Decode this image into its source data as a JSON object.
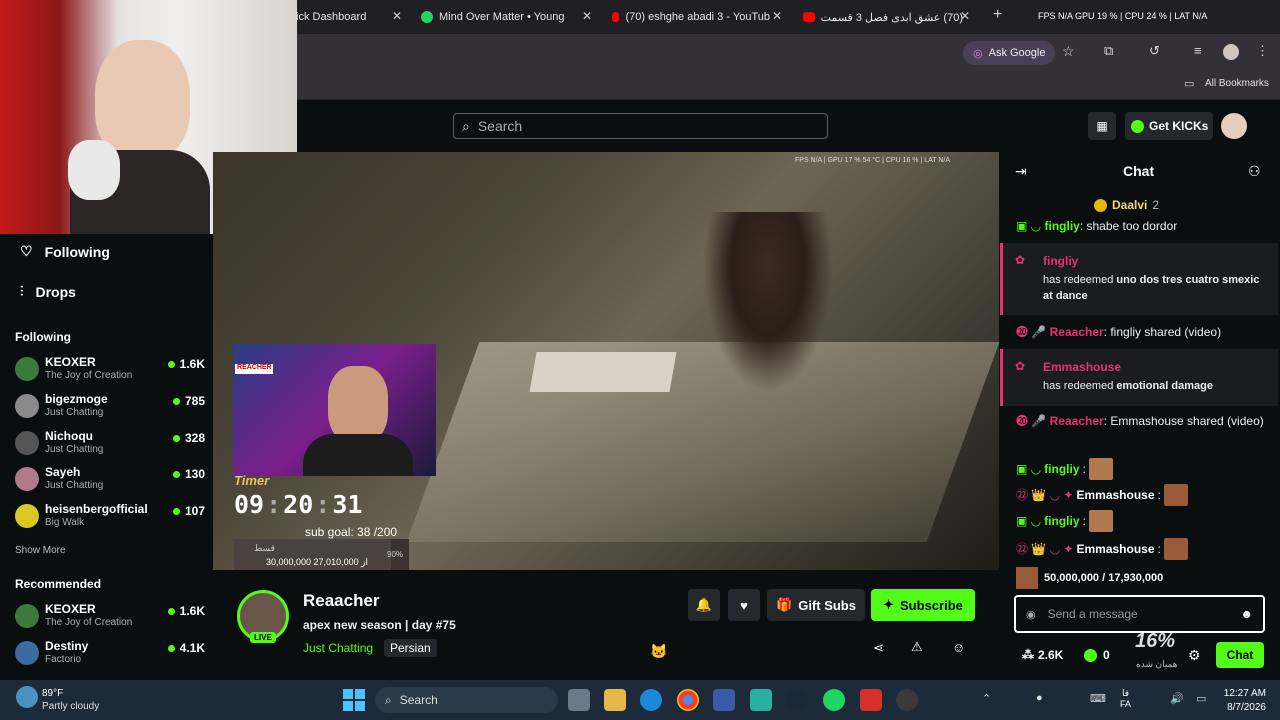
{
  "browser": {
    "tabs": [
      {
        "label": "ick Dashboard"
      },
      {
        "label": "Mind Over Matter • Young"
      },
      {
        "label": "(70) eshghe abadi 3 - YouTub"
      },
      {
        "label": "(70) عشق ابدی فصل 3 قسمت"
      }
    ],
    "perf_overlay": "FPS  N/A  GPU  19 %  |  CPU  24 %  |  LAT  N/A",
    "ask_google": "Ask Google",
    "all_bookmarks": "All Bookmarks"
  },
  "kick": {
    "search_placeholder": "Search",
    "get_kicks": "Get KICKs"
  },
  "sidebar": {
    "following_nav": "Following",
    "drops_nav": "Drops",
    "following_header": "Following",
    "following": [
      {
        "name": "KEOXER",
        "category": "The Joy of Creation",
        "viewers": "1.6K",
        "color": "#3a7a3a"
      },
      {
        "name": "bigezmoge",
        "category": "Just Chatting",
        "viewers": "785",
        "color": "#8a8a8a"
      },
      {
        "name": "Nichoqu",
        "category": "Just Chatting",
        "viewers": "328",
        "color": "#555"
      },
      {
        "name": "Sayeh",
        "category": "Just Chatting",
        "viewers": "130",
        "color": "#b07a8a"
      },
      {
        "name": "heisenbergofficial",
        "category": "Big Walk",
        "viewers": "107",
        "color": "#d8c820"
      }
    ],
    "show_more": "Show More",
    "recommended_header": "Recommended",
    "recommended": [
      {
        "name": "KEOXER",
        "category": "The Joy of Creation",
        "viewers": "1.6K",
        "color": "#3a7a3a"
      },
      {
        "name": "Destiny",
        "category": "Factorio",
        "viewers": "4.1K",
        "color": "#3a6aa0"
      }
    ]
  },
  "video": {
    "stats": "FPS  N/A  |  GPU  17 %  54 °C  |  CPU  16 %  |  LAT  N/A",
    "timer_label": "Timer",
    "timer_hh": "09",
    "timer_mm": "20",
    "timer_ss": "31",
    "sub_goal": "sub goal: 38 /200",
    "overlay_persian": "قسط",
    "overlay_amounts": "30,000,000 از 27,010,000",
    "overlay_percent": "90%",
    "cam_label": "REACHER"
  },
  "streamer": {
    "name": "Reaacher",
    "title": "apex new season | day #75",
    "category": "Just Chatting",
    "tag": "Persian",
    "live_badge": "LIVE",
    "gift_subs": "Gift Subs",
    "subscribe": "Subscribe"
  },
  "chat": {
    "header": "Chat",
    "pinned_user": "Daalvi",
    "pinned_count": "2",
    "messages": [
      {
        "user": "fingliy",
        "text": ": shabe too dordor",
        "color": "#53fc18"
      },
      {
        "user": "Reaacher",
        "text": ": fingliy shared (video)",
        "color": "#e5336d"
      },
      {
        "user": "Reaacher",
        "text": ": Emmashouse shared (video)",
        "color": "#e5336d"
      },
      {
        "user": "fingliy",
        "text": ":",
        "color": "#53fc18"
      },
      {
        "user": "Emmashouse",
        "text": ":",
        "color": "#ffffff"
      },
      {
        "user": "fingliy",
        "text": ":",
        "color": "#53fc18"
      },
      {
        "user": "Emmashouse",
        "text": ":",
        "color": "#ffffff"
      }
    ],
    "redeem1_user": "fingliy",
    "redeem1_text": "has redeemed ",
    "redeem1_reward": "uno dos tres cuatro smexic at dance",
    "redeem2_user": "Emmashouse",
    "redeem2_text": "has redeemed ",
    "redeem2_reward": "emotional damage",
    "overlay_amounts": "50,000,000 / 17,930,000",
    "overlay_percent": "16%",
    "overlay_persian": "همیان شده",
    "send_placeholder": "Send a message",
    "kicks": "2.6K",
    "points": "0",
    "chat_button": "Chat"
  },
  "taskbar": {
    "temp": "89°F",
    "weather": "Partly cloudy",
    "search": "Search",
    "lang_top": "فا",
    "lang_bottom": "FA",
    "time": "12:27 AM",
    "date": "8/7/2026"
  }
}
